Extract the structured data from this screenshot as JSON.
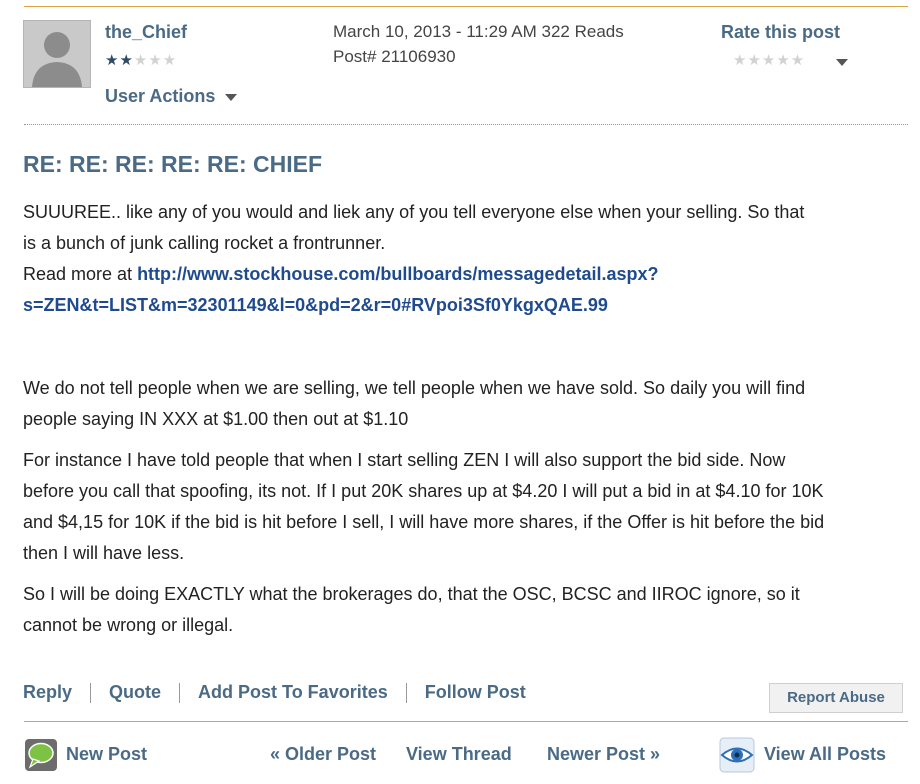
{
  "post": {
    "author": "the_Chief",
    "author_rating": 2,
    "user_actions_label": "User Actions",
    "date_line": "March 10, 2013 - 11:29 AM 322 Reads",
    "post_number_line": "Post# 21106930",
    "rate_label": "Rate this post",
    "rate_value": 0,
    "title": "RE: RE: RE: RE: RE: CHIEF",
    "body": {
      "p1_line1": "SUUUREE.. like any of you would and liek any of you tell everyone else when your selling.   So that",
      "p1_line2": "is a bunch of junk calling rocket a frontrunner.",
      "read_more_prefix": "Read more at ",
      "read_more_link_line1": "http://www.stockhouse.com/bullboards/messagedetail.aspx?",
      "read_more_link_line2": "s=ZEN&t=LIST&m=32301149&l=0&pd=2&r=0#RVpoi3Sf0YkgxQAE.99",
      "p2_line1": "We do not tell people when we are selling, we tell people when we have sold. So daily you will find",
      "p2_line2": "people saying IN XXX at $1.00 then out at $1.10",
      "p3_line1": "For instance I have told people that when I start selling ZEN I will also support the bid side. Now",
      "p3_line2": "before you call that spoofing, its not. If I put 20K shares up at $4.20 I will put a bid in at $4.10 for 10K",
      "p3_line3": "and $4,15 for 10K if the bid is hit before I sell, I will have more shares, if the Offer is hit before the bid",
      "p3_line4": "then I will have less.",
      "p4_line1": "So I will be doing EXACTLY what the brokerages do, that the OSC, BCSC and IIROC ignore, so it",
      "p4_line2": "cannot be wrong or illegal."
    }
  },
  "actions": {
    "reply": "Reply",
    "quote": "Quote",
    "favorites": "Add Post To Favorites",
    "follow": "Follow Post",
    "report": "Report Abuse"
  },
  "nav": {
    "new_post": "New Post",
    "older": "« Older Post",
    "thread": "View Thread",
    "newer": "Newer Post »",
    "all_posts": "View All Posts"
  },
  "colors": {
    "accent": "#d9a441",
    "link": "#1f4b8e",
    "heading": "#4a6a86"
  }
}
